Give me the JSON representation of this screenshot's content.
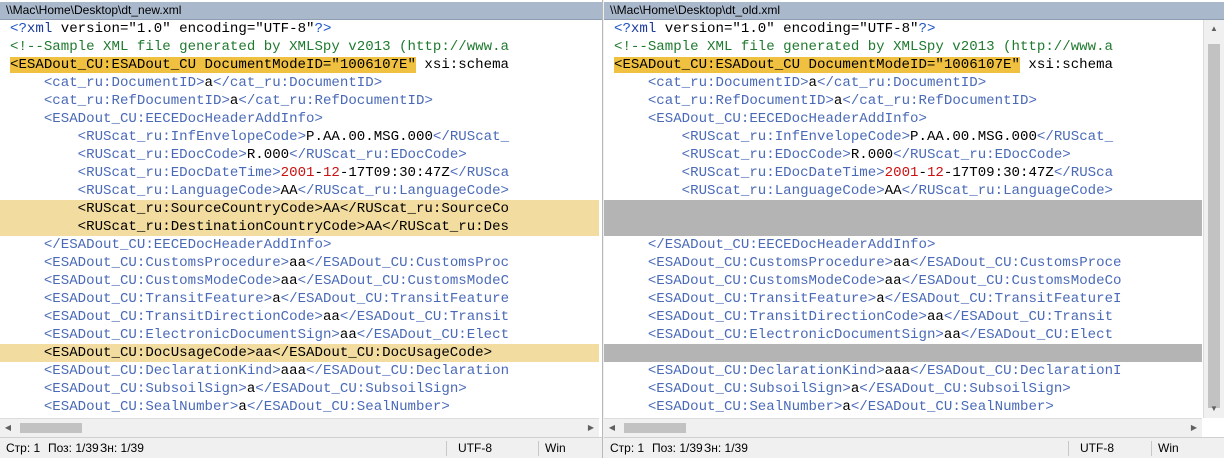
{
  "left": {
    "title": "\\\\Mac\\Home\\Desktop\\dt_new.xml",
    "status": {
      "str": "Стр: 1",
      "pos": "Поз: 1/39",
      "zn": "Зн: 1/39",
      "encoding": "UTF-8",
      "eol": "Win"
    },
    "lines": [
      {
        "kind": "normal",
        "tokens": [
          {
            "t": "pi",
            "v": "<?"
          },
          {
            "t": "attr",
            "v": "xml"
          },
          {
            "t": "text",
            "v": " version=\"1.0\" encoding=\"UTF-8\""
          },
          {
            "t": "pi",
            "v": "?>"
          }
        ]
      },
      {
        "kind": "normal",
        "tokens": [
          {
            "t": "comment",
            "v": "<!--Sample XML file generated by XMLSpy v2013 (http://www.a"
          }
        ]
      },
      {
        "kind": "root",
        "tokens": [
          {
            "t": "text",
            "v": "<ESADout_CU:ESADout_CU DocumentModeID=\"1006107E\""
          },
          {
            "t": "plain",
            "v": " xsi:schema"
          }
        ]
      },
      {
        "kind": "normal",
        "tokens": [
          {
            "t": "text",
            "v": "    "
          },
          {
            "t": "tag",
            "v": "<cat_ru:DocumentID>"
          },
          {
            "t": "val",
            "v": "a"
          },
          {
            "t": "tag",
            "v": "</cat_ru:DocumentID>"
          }
        ]
      },
      {
        "kind": "normal",
        "tokens": [
          {
            "t": "text",
            "v": "    "
          },
          {
            "t": "tag",
            "v": "<cat_ru:RefDocumentID>"
          },
          {
            "t": "val",
            "v": "a"
          },
          {
            "t": "tag",
            "v": "</cat_ru:RefDocumentID>"
          }
        ]
      },
      {
        "kind": "normal",
        "tokens": [
          {
            "t": "text",
            "v": "    "
          },
          {
            "t": "tag",
            "v": "<ESADout_CU:EECEDocHeaderAddInfo>"
          }
        ]
      },
      {
        "kind": "normal",
        "tokens": [
          {
            "t": "text",
            "v": "        "
          },
          {
            "t": "tag",
            "v": "<RUScat_ru:InfEnvelopeCode>"
          },
          {
            "t": "val",
            "v": "P.AA.00.MSG.000"
          },
          {
            "t": "tag",
            "v": "</RUScat_"
          }
        ]
      },
      {
        "kind": "normal",
        "tokens": [
          {
            "t": "text",
            "v": "        "
          },
          {
            "t": "tag",
            "v": "<RUScat_ru:EDocCode>"
          },
          {
            "t": "val",
            "v": "R.000"
          },
          {
            "t": "tag",
            "v": "</RUScat_ru:EDocCode>"
          }
        ]
      },
      {
        "kind": "normal",
        "tokens": [
          {
            "t": "text",
            "v": "        "
          },
          {
            "t": "tag",
            "v": "<RUScat_ru:EDocDateTime>"
          },
          {
            "t": "red",
            "v": "2001"
          },
          {
            "t": "val",
            "v": "-"
          },
          {
            "t": "red",
            "v": "12"
          },
          {
            "t": "val",
            "v": "-17T09:30:47Z"
          },
          {
            "t": "tag",
            "v": "</RUSca"
          }
        ]
      },
      {
        "kind": "normal",
        "tokens": [
          {
            "t": "text",
            "v": "        "
          },
          {
            "t": "tag",
            "v": "<RUScat_ru:LanguageCode>"
          },
          {
            "t": "val",
            "v": "AA"
          },
          {
            "t": "tag",
            "v": "</RUScat_ru:LanguageCode>"
          }
        ]
      },
      {
        "kind": "hl",
        "tokens": [
          {
            "t": "plain",
            "v": "        <RUScat_ru:SourceCountryCode>AA</RUScat_ru:SourceCo"
          }
        ]
      },
      {
        "kind": "hl",
        "tokens": [
          {
            "t": "plain",
            "v": "        <RUScat_ru:DestinationCountryCode>AA</RUScat_ru:Des"
          }
        ]
      },
      {
        "kind": "normal",
        "tokens": [
          {
            "t": "text",
            "v": "    "
          },
          {
            "t": "tag",
            "v": "</ESADout_CU:EECEDocHeaderAddInfo>"
          }
        ]
      },
      {
        "kind": "normal",
        "tokens": [
          {
            "t": "text",
            "v": "    "
          },
          {
            "t": "tag",
            "v": "<ESADout_CU:CustomsProcedure>"
          },
          {
            "t": "val",
            "v": "aa"
          },
          {
            "t": "tag",
            "v": "</ESADout_CU:CustomsProc"
          }
        ]
      },
      {
        "kind": "normal",
        "tokens": [
          {
            "t": "text",
            "v": "    "
          },
          {
            "t": "tag",
            "v": "<ESADout_CU:CustomsModeCode>"
          },
          {
            "t": "val",
            "v": "aa"
          },
          {
            "t": "tag",
            "v": "</ESADout_CU:CustomsModeC"
          }
        ]
      },
      {
        "kind": "normal",
        "tokens": [
          {
            "t": "text",
            "v": "    "
          },
          {
            "t": "tag",
            "v": "<ESADout_CU:TransitFeature>"
          },
          {
            "t": "val",
            "v": "a"
          },
          {
            "t": "tag",
            "v": "</ESADout_CU:TransitFeature"
          }
        ]
      },
      {
        "kind": "normal",
        "tokens": [
          {
            "t": "text",
            "v": "    "
          },
          {
            "t": "tag",
            "v": "<ESADout_CU:TransitDirectionCode>"
          },
          {
            "t": "val",
            "v": "aa"
          },
          {
            "t": "tag",
            "v": "</ESADout_CU:Transit"
          }
        ]
      },
      {
        "kind": "normal",
        "tokens": [
          {
            "t": "text",
            "v": "    "
          },
          {
            "t": "tag",
            "v": "<ESADout_CU:ElectronicDocumentSign>"
          },
          {
            "t": "val",
            "v": "aa"
          },
          {
            "t": "tag",
            "v": "</ESADout_CU:Elect"
          }
        ]
      },
      {
        "kind": "hl",
        "tokens": [
          {
            "t": "plain",
            "v": "    <ESADout_CU:DocUsageCode>aa</ESADout_CU:DocUsageCode>"
          }
        ]
      },
      {
        "kind": "normal",
        "tokens": [
          {
            "t": "text",
            "v": "    "
          },
          {
            "t": "tag",
            "v": "<ESADout_CU:DeclarationKind>"
          },
          {
            "t": "val",
            "v": "aaa"
          },
          {
            "t": "tag",
            "v": "</ESADout_CU:Declaration"
          }
        ]
      },
      {
        "kind": "normal",
        "tokens": [
          {
            "t": "text",
            "v": "    "
          },
          {
            "t": "tag",
            "v": "<ESADout_CU:SubsoilSign>"
          },
          {
            "t": "val",
            "v": "a"
          },
          {
            "t": "tag",
            "v": "</ESADout_CU:SubsoilSign>"
          }
        ]
      },
      {
        "kind": "normal",
        "tokens": [
          {
            "t": "text",
            "v": "    "
          },
          {
            "t": "tag",
            "v": "<ESADout_CU:SealNumber>"
          },
          {
            "t": "val",
            "v": "a"
          },
          {
            "t": "tag",
            "v": "</ESADout_CU:SealNumber>"
          }
        ]
      }
    ]
  },
  "right": {
    "title": "\\\\Mac\\Home\\Desktop\\dt_old.xml",
    "status": {
      "str": "Стр: 1",
      "pos": "Поз: 1/39",
      "zn": "Зн: 1/39",
      "encoding": "UTF-8",
      "eol": "Win"
    },
    "lines": [
      {
        "kind": "normal",
        "tokens": [
          {
            "t": "pi",
            "v": "<?"
          },
          {
            "t": "attr",
            "v": "xml"
          },
          {
            "t": "text",
            "v": " version=\"1.0\" encoding=\"UTF-8\""
          },
          {
            "t": "pi",
            "v": "?>"
          }
        ]
      },
      {
        "kind": "normal",
        "tokens": [
          {
            "t": "comment",
            "v": "<!--Sample XML file generated by XMLSpy v2013 (http://www.a"
          }
        ]
      },
      {
        "kind": "root",
        "tokens": [
          {
            "t": "text",
            "v": "<ESADout_CU:ESADout_CU DocumentModeID=\"1006107E\""
          },
          {
            "t": "plain",
            "v": " xsi:schema"
          }
        ]
      },
      {
        "kind": "normal",
        "tokens": [
          {
            "t": "text",
            "v": "    "
          },
          {
            "t": "tag",
            "v": "<cat_ru:DocumentID>"
          },
          {
            "t": "val",
            "v": "a"
          },
          {
            "t": "tag",
            "v": "</cat_ru:DocumentID>"
          }
        ]
      },
      {
        "kind": "normal",
        "tokens": [
          {
            "t": "text",
            "v": "    "
          },
          {
            "t": "tag",
            "v": "<cat_ru:RefDocumentID>"
          },
          {
            "t": "val",
            "v": "a"
          },
          {
            "t": "tag",
            "v": "</cat_ru:RefDocumentID>"
          }
        ]
      },
      {
        "kind": "normal",
        "tokens": [
          {
            "t": "text",
            "v": "    "
          },
          {
            "t": "tag",
            "v": "<ESADout_CU:EECEDocHeaderAddInfo>"
          }
        ]
      },
      {
        "kind": "normal",
        "tokens": [
          {
            "t": "text",
            "v": "        "
          },
          {
            "t": "tag",
            "v": "<RUScat_ru:InfEnvelopeCode>"
          },
          {
            "t": "val",
            "v": "P.AA.00.MSG.000"
          },
          {
            "t": "tag",
            "v": "</RUScat_"
          }
        ]
      },
      {
        "kind": "normal",
        "tokens": [
          {
            "t": "text",
            "v": "        "
          },
          {
            "t": "tag",
            "v": "<RUScat_ru:EDocCode>"
          },
          {
            "t": "val",
            "v": "R.000"
          },
          {
            "t": "tag",
            "v": "</RUScat_ru:EDocCode>"
          }
        ]
      },
      {
        "kind": "normal",
        "tokens": [
          {
            "t": "text",
            "v": "        "
          },
          {
            "t": "tag",
            "v": "<RUScat_ru:EDocDateTime>"
          },
          {
            "t": "red",
            "v": "2001"
          },
          {
            "t": "val",
            "v": "-"
          },
          {
            "t": "red",
            "v": "12"
          },
          {
            "t": "val",
            "v": "-17T09:30:47Z"
          },
          {
            "t": "tag",
            "v": "</RUSca"
          }
        ]
      },
      {
        "kind": "normal",
        "tokens": [
          {
            "t": "text",
            "v": "        "
          },
          {
            "t": "tag",
            "v": "<RUScat_ru:LanguageCode>"
          },
          {
            "t": "val",
            "v": "AA"
          },
          {
            "t": "tag",
            "v": "</RUScat_ru:LanguageCode>"
          }
        ]
      },
      {
        "kind": "empty",
        "tokens": []
      },
      {
        "kind": "empty",
        "tokens": []
      },
      {
        "kind": "normal",
        "tokens": [
          {
            "t": "text",
            "v": "    "
          },
          {
            "t": "tag",
            "v": "</ESADout_CU:EECEDocHeaderAddInfo>"
          }
        ]
      },
      {
        "kind": "normal",
        "tokens": [
          {
            "t": "text",
            "v": "    "
          },
          {
            "t": "tag",
            "v": "<ESADout_CU:CustomsProcedure>"
          },
          {
            "t": "val",
            "v": "aa"
          },
          {
            "t": "tag",
            "v": "</ESADout_CU:CustomsProce"
          }
        ]
      },
      {
        "kind": "normal",
        "tokens": [
          {
            "t": "text",
            "v": "    "
          },
          {
            "t": "tag",
            "v": "<ESADout_CU:CustomsModeCode>"
          },
          {
            "t": "val",
            "v": "aa"
          },
          {
            "t": "tag",
            "v": "</ESADout_CU:CustomsModeCo"
          }
        ]
      },
      {
        "kind": "normal",
        "tokens": [
          {
            "t": "text",
            "v": "    "
          },
          {
            "t": "tag",
            "v": "<ESADout_CU:TransitFeature>"
          },
          {
            "t": "val",
            "v": "a"
          },
          {
            "t": "tag",
            "v": "</ESADout_CU:TransitFeatureI"
          }
        ]
      },
      {
        "kind": "normal",
        "tokens": [
          {
            "t": "text",
            "v": "    "
          },
          {
            "t": "tag",
            "v": "<ESADout_CU:TransitDirectionCode>"
          },
          {
            "t": "val",
            "v": "aa"
          },
          {
            "t": "tag",
            "v": "</ESADout_CU:Transit"
          }
        ]
      },
      {
        "kind": "normal",
        "tokens": [
          {
            "t": "text",
            "v": "    "
          },
          {
            "t": "tag",
            "v": "<ESADout_CU:ElectronicDocumentSign>"
          },
          {
            "t": "val",
            "v": "aa"
          },
          {
            "t": "tag",
            "v": "</ESADout_CU:Elect"
          }
        ]
      },
      {
        "kind": "empty",
        "tokens": []
      },
      {
        "kind": "normal",
        "tokens": [
          {
            "t": "text",
            "v": "    "
          },
          {
            "t": "tag",
            "v": "<ESADout_CU:DeclarationKind>"
          },
          {
            "t": "val",
            "v": "aaa"
          },
          {
            "t": "tag",
            "v": "</ESADout_CU:DeclarationI"
          }
        ]
      },
      {
        "kind": "normal",
        "tokens": [
          {
            "t": "text",
            "v": "    "
          },
          {
            "t": "tag",
            "v": "<ESADout_CU:SubsoilSign>"
          },
          {
            "t": "val",
            "v": "a"
          },
          {
            "t": "tag",
            "v": "</ESADout_CU:SubsoilSign>"
          }
        ]
      },
      {
        "kind": "normal",
        "tokens": [
          {
            "t": "text",
            "v": "    "
          },
          {
            "t": "tag",
            "v": "<ESADout_CU:SealNumber>"
          },
          {
            "t": "val",
            "v": "a"
          },
          {
            "t": "tag",
            "v": "</ESADout_CU:SealNumber>"
          }
        ]
      }
    ]
  },
  "colors": {
    "titlebar": "#aab8cc",
    "diff_changed": "#f2dca0",
    "diff_root": "#f0c040",
    "diff_empty": "#b4b4b4",
    "tag": "#4a6ab8",
    "comment": "#1f7a2f",
    "number": "#cc1111"
  },
  "icons": [
    "scroll-up-arrow-icon",
    "scroll-down-arrow-icon",
    "scroll-left-arrow-icon",
    "scroll-right-arrow-icon"
  ]
}
